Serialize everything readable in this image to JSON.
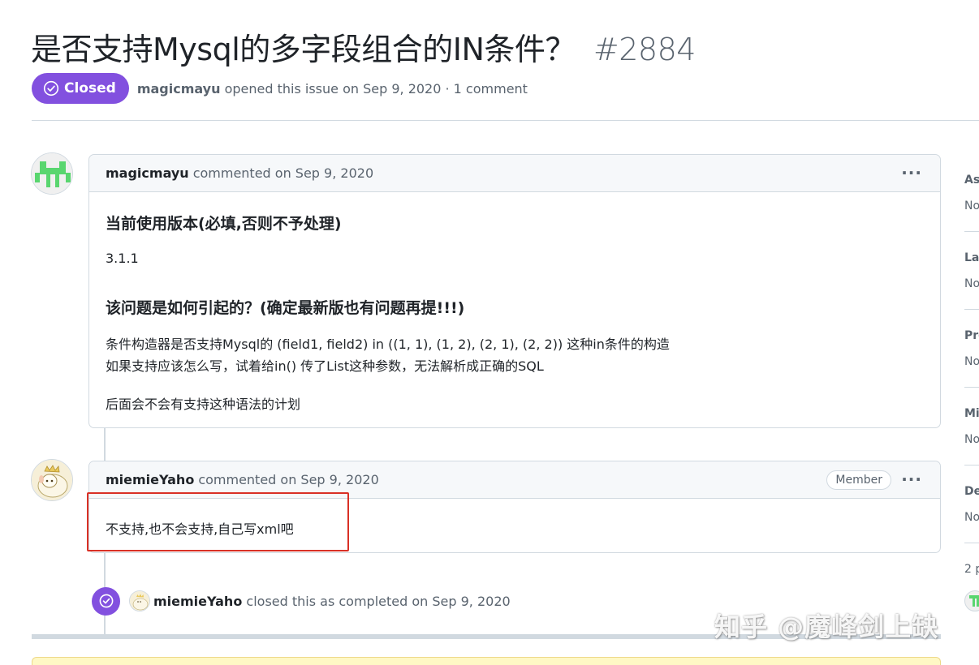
{
  "issue": {
    "title": "是否支持Mysql的多字段组合的IN条件？",
    "number": "#2884",
    "state": "Closed",
    "author": "magicmayu",
    "opened_text": "opened this issue on Sep 9, 2020 · 1 comment"
  },
  "comments": [
    {
      "author": "magicmayu",
      "meta": "commented on Sep 9, 2020",
      "heading1": "当前使用版本(必填,否则不予处理)",
      "version": "3.1.1",
      "heading2": "该问题是如何引起的？(确定最新版也有问题再提!!!)",
      "line1": "条件构造器是否支持Mysql的 (field1, field2) in ((1, 1), (1, 2), (2, 1), (2, 2)) 这种in条件的构造",
      "line2": "如果支持应该怎么写，试着给in() 传了List这种参数，无法解析成正确的SQL",
      "line3": "后面会不会有支持这种语法的计划"
    },
    {
      "author": "miemieYaho",
      "meta": "commented on Sep 9, 2020",
      "role": "Member",
      "body": "不支持,也不会支持,自己写xml吧"
    }
  ],
  "event": {
    "author": "miemieYaho",
    "text": "closed this as completed on Sep 9, 2020"
  },
  "sidebar": {
    "sections": [
      {
        "head": "As",
        "value": "No"
      },
      {
        "head": "Lal",
        "value": "No"
      },
      {
        "head": "Pro",
        "value": "No"
      },
      {
        "head": "Mi",
        "value": "No"
      },
      {
        "head": "De",
        "value": "No"
      }
    ],
    "participants": "2 p"
  },
  "menu_dots": "···",
  "watermark": "知乎 @魔峰剑上缺",
  "colors": {
    "closed_purple": "#8250df",
    "border": "#d1d9e0",
    "highlight_red": "#d93025"
  }
}
